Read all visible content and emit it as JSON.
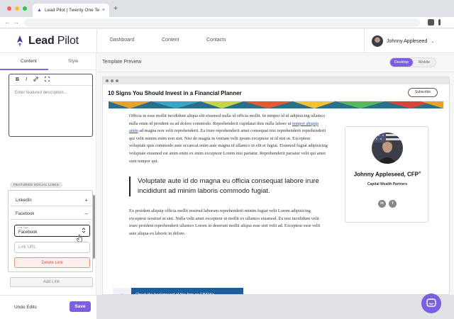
{
  "browser": {
    "tab_title": "Lead Pilot | Twenty One Ten",
    "tab_close": "×",
    "new_tab": "+",
    "back": "←",
    "forward": "→",
    "window_controls": {
      "colors": [
        "#ff5f57",
        "#febc2e",
        "#28c840"
      ]
    }
  },
  "topbar": {
    "logo_bold": "Lead",
    "logo_regular": " Pilot",
    "nav": [
      "Dashboard",
      "Content",
      "Contacts"
    ],
    "user_name": "Johnny Appleseed",
    "user_chevron": "⌄"
  },
  "sidebar": {
    "tabs": [
      "Content",
      "Style"
    ],
    "active_tab": "Content",
    "editor": {
      "tools": [
        "B",
        "I",
        "🔗",
        "⛶"
      ],
      "placeholder": "Enter featured description..."
    },
    "featured_label": "FEATURED SOCIAL LINKS",
    "social_links": [
      {
        "label": "LinkedIn",
        "action": "+"
      },
      {
        "label": "Facebook",
        "action": "–"
      }
    ],
    "type_select": {
      "label": "Link Type",
      "value": "Facebook",
      "chevron": "⌃⌄"
    },
    "url_placeholder": "Link URL",
    "delete_label": "Delete Link",
    "add_link_label": "Add Link",
    "undo_label": "Undo Edits",
    "save_label": "Save"
  },
  "main": {
    "preview_title": "Template Preview",
    "view_options": [
      "Desktop",
      "Mobile"
    ],
    "active_view": "Desktop"
  },
  "preview": {
    "site_title": "10 Signs You Should Invest in a Financial Planner",
    "subscribe_label": "Subscribe",
    "para1_a": "Officia in esse mollit incididunt aliqua elit eiusmod nulla id officia mollit. In tempor id id adipisicing ullamco nulla enim id proident ea ad dolore commodo. Reprehenderit cupidatat duis nulla labore ut ",
    "para1_link": "tempor aliquip anim",
    "para1_b": " ad magna non velit reprehenderit. Ea irure reprehenderit amet consequat nisi reprehenderit reprehenderit qui velit minim enim non sint. Nisi do magna in veniam velit ipsum excepteur ut id nisi ut. Excepteur voluptate quis commodo aute occaecat enim aute magna id ullamco in elit et fugiat. Eiusmod fugiat adipisicing voluptate eiusmod est anim enim ex enim excepteur Lorem nisi pariatur. Reprehenderit pariatur velit qui amet sunt tempor qui.",
    "quote": "Voluptate aute id do magna eu officia consequat labore irure incididunt ad minim laboris commodo fugiat.",
    "para2": "Ex proident aliquip officia mollit nostrud laborum reprehenderit minim fugiat velit Lorem adipisicing excepteur nostrud ut sint. Nulla velit amet excepteur ut mollit ex ullamco eiusmod. Eu nisi incididunt velit irure proident reprehenderit ullamco Lorem in deserunt mollit aliqua esse sint velit ad. Excepteur esse velit aute aliqua eu laboris in dolore.",
    "card_name": "Johnny Appleseed, CFP",
    "card_name_sup": "®",
    "card_firm": "Capital Wealth Partners",
    "social_icons": [
      "in",
      "f"
    ],
    "broker_text": "Check the background of this firm on FINRA's BrokerCheck."
  },
  "colors": {
    "accent": "#7b5fe0",
    "delete": "#d05a3c",
    "broker_bg": "#1f5d9a",
    "link": "#3344aa"
  }
}
